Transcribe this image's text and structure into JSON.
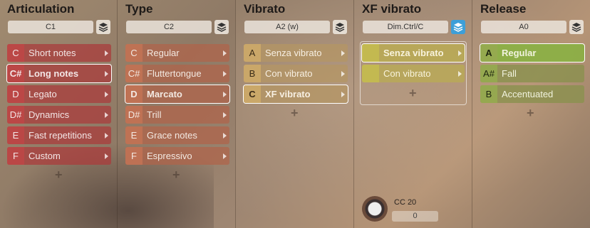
{
  "articulation": {
    "title": "Articulation",
    "selector": "C1",
    "items": [
      {
        "key": "C",
        "label": "Short notes"
      },
      {
        "key": "C#",
        "label": "Long notes"
      },
      {
        "key": "D",
        "label": "Legato"
      },
      {
        "key": "D#",
        "label": "Dynamics"
      },
      {
        "key": "E",
        "label": "Fast repetitions"
      },
      {
        "key": "F",
        "label": "Custom"
      }
    ],
    "selected_index": 1
  },
  "type": {
    "title": "Type",
    "selector": "C2",
    "items": [
      {
        "key": "C",
        "label": "Regular"
      },
      {
        "key": "C#",
        "label": "Fluttertongue"
      },
      {
        "key": "D",
        "label": "Marcato"
      },
      {
        "key": "D#",
        "label": "Trill"
      },
      {
        "key": "E",
        "label": "Grace notes"
      },
      {
        "key": "F",
        "label": "Espressivo"
      }
    ],
    "selected_index": 2
  },
  "vibrato": {
    "title": "Vibrato",
    "selector": "A2 (w)",
    "items": [
      {
        "key": "A",
        "label": "Senza vibrato"
      },
      {
        "key": "B",
        "label": "Con vibrato"
      },
      {
        "key": "C",
        "label": "XF vibrato"
      }
    ],
    "selected_index": 2
  },
  "xf_vibrato": {
    "title": "XF vibrato",
    "selector": "Dim.Ctrl/C",
    "items": [
      {
        "key": "",
        "label": "Senza vibrato"
      },
      {
        "key": "",
        "label": "Con vibrato"
      }
    ],
    "selected_index": 0,
    "cc_label": "CC 20",
    "cc_value": "0"
  },
  "release": {
    "title": "Release",
    "selector": "A0",
    "items": [
      {
        "key": "A",
        "label": "Regular"
      },
      {
        "key": "A#",
        "label": "Fall"
      },
      {
        "key": "B",
        "label": "Accentuated"
      }
    ],
    "selected_index": 0
  },
  "plus_symbol": "+"
}
